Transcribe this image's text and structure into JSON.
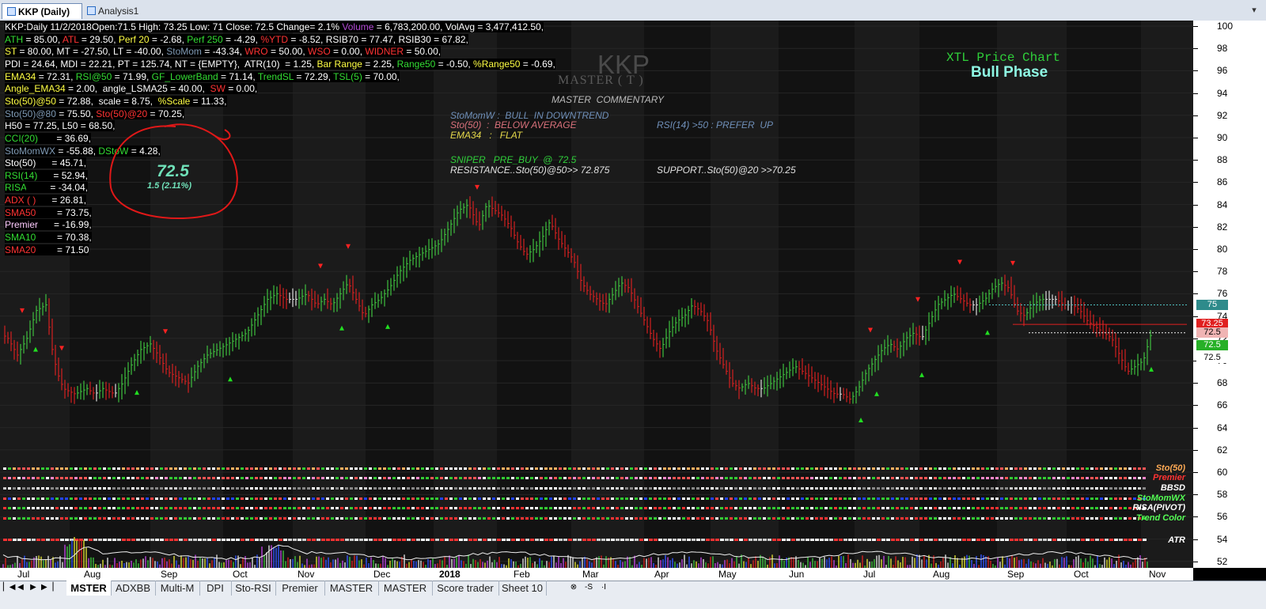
{
  "tabs": [
    {
      "label": "KKP (Daily)",
      "active": true
    },
    {
      "label": "Analysis1",
      "active": false
    }
  ],
  "info_lines": [
    [
      {
        "t": "KKP:Daily 11/2/2018Open:71.5 High: 73.25 Low: 71 Close: 72.5 Change= 2.1% ",
        "c": "#ffffff"
      },
      {
        "t": "Volume",
        "c": "#b44bd6"
      },
      {
        "t": " = 6,783,200.00, VolAvg = 3,477,412.50,",
        "c": "#ffffff"
      }
    ],
    [
      {
        "t": "ATH",
        "c": "#33dd33"
      },
      {
        "t": " = 85.00, ",
        "c": "#ffffff"
      },
      {
        "t": "ATL",
        "c": "#ff3333"
      },
      {
        "t": " = 29.50, ",
        "c": "#ffffff"
      },
      {
        "t": "Perf 20",
        "c": "#ffff44"
      },
      {
        "t": " = -2.68, ",
        "c": "#ffffff"
      },
      {
        "t": "Perf 250",
        "c": "#33dd33"
      },
      {
        "t": " = -4.29, ",
        "c": "#ffffff"
      },
      {
        "t": "%YTD",
        "c": "#ff3333"
      },
      {
        "t": " = -8.52, RSIB70 = 77.47, RSIB30 = 67.82,",
        "c": "#ffffff"
      }
    ],
    [
      {
        "t": "ST",
        "c": "#ffff44"
      },
      {
        "t": " = 80.00, MT = -27.50, LT = -40.00, ",
        "c": "#ffffff"
      },
      {
        "t": "StoMom",
        "c": "#7f9ab4"
      },
      {
        "t": " = -43.34, ",
        "c": "#ffffff"
      },
      {
        "t": "WRO",
        "c": "#ff3333"
      },
      {
        "t": " = 50.00, ",
        "c": "#ffffff"
      },
      {
        "t": "WSO",
        "c": "#ff3333"
      },
      {
        "t": " = 0.00, ",
        "c": "#ffffff"
      },
      {
        "t": "WIDNER",
        "c": "#ff3333"
      },
      {
        "t": " = 50.00,",
        "c": "#ffffff"
      }
    ],
    [
      {
        "t": "PDI = 24.64, MDI = 22.21, PT = 125.74, NT = {EMPTY},  ATR(10)  = 1.25, ",
        "c": "#ffffff"
      },
      {
        "t": "Bar Range",
        "c": "#ffff44"
      },
      {
        "t": " = 2.25, ",
        "c": "#ffffff"
      },
      {
        "t": "Range50",
        "c": "#33dd33"
      },
      {
        "t": " = -0.50, ",
        "c": "#ffffff"
      },
      {
        "t": "%Range50",
        "c": "#ffff44"
      },
      {
        "t": " = -0.69,",
        "c": "#ffffff"
      }
    ],
    [
      {
        "t": "EMA34",
        "c": "#ffff44"
      },
      {
        "t": " = 72.31, ",
        "c": "#ffffff"
      },
      {
        "t": "RSI@50",
        "c": "#33dd33"
      },
      {
        "t": " = 71.99, ",
        "c": "#ffffff"
      },
      {
        "t": "GF_LowerBand",
        "c": "#33dd33"
      },
      {
        "t": " = 71.14, ",
        "c": "#ffffff"
      },
      {
        "t": "TrendSL",
        "c": "#33dd33"
      },
      {
        "t": " = 72.29, ",
        "c": "#ffffff"
      },
      {
        "t": "TSL(5)",
        "c": "#33dd33"
      },
      {
        "t": " = 70.00,",
        "c": "#ffffff"
      }
    ],
    [
      {
        "t": "Angle_EMA34",
        "c": "#ffff44"
      },
      {
        "t": " = 2.00,  angle_LSMA25 = 40.00,  ",
        "c": "#ffffff"
      },
      {
        "t": "SW",
        "c": "#ff3333"
      },
      {
        "t": " = 0.00,",
        "c": "#ffffff"
      }
    ],
    [
      {
        "t": "Sto(50)@50",
        "c": "#ffff44"
      },
      {
        "t": " = 72.88,  scale = 8.75,  ",
        "c": "#ffffff"
      },
      {
        "t": "%Scale",
        "c": "#ffff44"
      },
      {
        "t": " = 11.33,",
        "c": "#ffffff"
      }
    ],
    [
      {
        "t": "Sto(50)@80",
        "c": "#7f9ab4"
      },
      {
        "t": " = 75.50, ",
        "c": "#ffffff"
      },
      {
        "t": "Sto(50)@20",
        "c": "#ff3333"
      },
      {
        "t": " = 70.25,",
        "c": "#ffffff"
      }
    ],
    [
      {
        "t": "H50 = 77.25, L50 = 68.50,",
        "c": "#ffffff"
      }
    ],
    [
      {
        "t": "CCI(20)",
        "c": "#33dd33"
      },
      {
        "t": "       = 36.69,",
        "c": "#ffffff"
      }
    ],
    [
      {
        "t": "StoMomWX",
        "c": "#7f9ab4"
      },
      {
        "t": " = -55.88, ",
        "c": "#ffffff"
      },
      {
        "t": "DStoW",
        "c": "#33dd33"
      },
      {
        "t": " = 4.28,",
        "c": "#ffffff"
      }
    ],
    [
      {
        "t": "Sto(50)",
        "c": "#ffffff"
      },
      {
        "t": "      = 45.71,",
        "c": "#ffffff"
      }
    ],
    [
      {
        "t": "RSI(14)",
        "c": "#33dd33"
      },
      {
        "t": "      = 52.94,",
        "c": "#ffffff"
      }
    ],
    [
      {
        "t": "RISA",
        "c": "#33dd33"
      },
      {
        "t": "         = -34.04,",
        "c": "#ffffff"
      }
    ],
    [
      {
        "t": "ADX ( )",
        "c": "#ff3333"
      },
      {
        "t": "      = 26.81,",
        "c": "#ffffff"
      }
    ],
    [
      {
        "t": "SMA50",
        "c": "#ff3333"
      },
      {
        "t": "        = 73.75,",
        "c": "#ffffff"
      }
    ],
    [
      {
        "t": "Premier",
        "c": "#ffccff"
      },
      {
        "t": "      = -16.99,",
        "c": "#ffffff"
      }
    ],
    [
      {
        "t": "SMA10",
        "c": "#33dd33"
      },
      {
        "t": "        = 70.38,",
        "c": "#ffffff"
      }
    ],
    [
      {
        "t": "SMA20",
        "c": "#ff3333"
      },
      {
        "t": "        = 71.50",
        "c": "#ffffff"
      }
    ]
  ],
  "price_circle": {
    "price": "72.5",
    "change": "1.5  (2.11%)"
  },
  "symbol": "KKP",
  "master_label": "MASTER  ( T )",
  "commentary_title": "MASTER  COMMENTARY",
  "commentary": [
    {
      "t": "StoMomW :  BULL  IN DOWNTREND",
      "c": "#6f8fb8"
    },
    {
      "t": "Sto(50)  :  BELOW AVERAGE",
      "c": "#d9717b"
    },
    {
      "t": "EMA34   :   FLAT",
      "c": "#e5d84a"
    },
    {
      "t": "SNIPER   PRE_BUY  @  72.5",
      "c": "#2fcf3a"
    },
    {
      "t": "RESISTANCE..Sto(50)@50>> 72.875",
      "c": "#e0e0e0"
    }
  ],
  "commentary_right": [
    {
      "t": "RSI(14) >50 : PREFER  UP",
      "c": "#6f8fb8"
    },
    {
      "t": "SUPPORT..Sto(50)@20 >>70.25",
      "c": "#e0e0e0"
    }
  ],
  "chart_title": "XTL Price Chart",
  "phase": "Bull Phase",
  "y_ticks": [
    "100",
    "98",
    "96",
    "94",
    "92",
    "90",
    "88",
    "86",
    "84",
    "82",
    "80",
    "78",
    "76",
    "74",
    "72",
    "70",
    "68",
    "66",
    "64",
    "62",
    "60",
    "58",
    "56",
    "54",
    "52"
  ],
  "price_tags": [
    {
      "v": "75",
      "bg": "#2e8b8b",
      "fg": "#ffffff"
    },
    {
      "v": "73.25",
      "bg": "#e02020",
      "fg": "#ffffff"
    },
    {
      "v": "72.5",
      "bg": "#f0b4b4",
      "fg": "#000000"
    },
    {
      "v": "72.5",
      "bg": "#27b027",
      "fg": "#ffffff"
    },
    {
      "v": "72.5",
      "bg": "#ffffff",
      "fg": "#000000"
    }
  ],
  "indicators": [
    {
      "label": "Sto(50)",
      "c": "#ffaa55"
    },
    {
      "label": "Premier",
      "c": "#ff3333"
    },
    {
      "label": "BBSD",
      "c": "#ffffff"
    },
    {
      "label": "StoMomWX",
      "c": "#55ff55"
    },
    {
      "label": "RISA(PIVOT)",
      "c": "#ffffff"
    },
    {
      "label": "Trend Color",
      "c": "#55ff55"
    },
    {
      "label": "ATR",
      "c": "#ffffff"
    }
  ],
  "x_ticks": [
    "Jul",
    "Aug",
    "Sep",
    "Oct",
    "Nov",
    "Dec",
    "2018",
    "Feb",
    "Mar",
    "Apr",
    "May",
    "Jun",
    "Jul",
    "Aug",
    "Sep",
    "Oct",
    "Nov"
  ],
  "sheets": [
    {
      "label": "MSTER",
      "active": true
    },
    {
      "label": "ADXBB",
      "active": false
    },
    {
      "label": "Multi-M",
      "active": false
    },
    {
      "label": "DPI",
      "active": false
    },
    {
      "label": "Sto-RSI",
      "active": false
    },
    {
      "label": "Premier",
      "active": false
    },
    {
      "label": "MASTER",
      "active": false
    },
    {
      "label": "MASTER",
      "active": false
    },
    {
      "label": "Score trader",
      "active": false
    },
    {
      "label": "Sheet 10",
      "active": false
    }
  ],
  "sheet_controls": {
    "add": "⊗",
    "first": "▏◀",
    "prev": "◀",
    "next": "▶",
    "last": "▶▕",
    "nav_sep": "-S",
    "nav_sep2": "·I"
  },
  "colors": {
    "up": "#3fbf3f",
    "down": "#d42020",
    "neutral": "#dddddd",
    "buy_marker": "#22dd22",
    "sell_marker": "#ff2222",
    "resistance": "#4fc0c0"
  },
  "chart_data": {
    "type": "ohlc-bar",
    "title": "XTL Price Chart",
    "ylim": [
      51,
      100.5
    ],
    "x_labels": [
      "Jul",
      "Aug",
      "Sep",
      "Oct",
      "Nov",
      "Dec",
      "2018",
      "Feb",
      "Mar",
      "Apr",
      "May",
      "Jun",
      "Jul",
      "Aug",
      "Sep",
      "Oct",
      "Nov"
    ],
    "close_path": [
      {
        "d": 0,
        "v": 72.5
      },
      {
        "d": 10,
        "v": 72
      },
      {
        "d": 22,
        "v": 70.5
      },
      {
        "d": 34,
        "v": 72
      },
      {
        "d": 46,
        "v": 74.5
      },
      {
        "d": 58,
        "v": 75
      },
      {
        "d": 66,
        "v": 71
      },
      {
        "d": 72,
        "v": 69
      },
      {
        "d": 80,
        "v": 67.5
      },
      {
        "d": 95,
        "v": 67
      },
      {
        "d": 110,
        "v": 67.5
      },
      {
        "d": 120,
        "v": 67
      },
      {
        "d": 130,
        "v": 67.5
      },
      {
        "d": 145,
        "v": 67
      },
      {
        "d": 155,
        "v": 68
      },
      {
        "d": 165,
        "v": 69.5
      },
      {
        "d": 178,
        "v": 71
      },
      {
        "d": 190,
        "v": 71.5
      },
      {
        "d": 200,
        "v": 70.5
      },
      {
        "d": 212,
        "v": 69
      },
      {
        "d": 225,
        "v": 68.5
      },
      {
        "d": 238,
        "v": 68
      },
      {
        "d": 250,
        "v": 69.5
      },
      {
        "d": 262,
        "v": 70.5
      },
      {
        "d": 275,
        "v": 71
      },
      {
        "d": 288,
        "v": 71.5
      },
      {
        "d": 300,
        "v": 72
      },
      {
        "d": 312,
        "v": 72.5
      },
      {
        "d": 325,
        "v": 74
      },
      {
        "d": 338,
        "v": 75.5
      },
      {
        "d": 350,
        "v": 76
      },
      {
        "d": 362,
        "v": 75.5
      },
      {
        "d": 375,
        "v": 75.5
      },
      {
        "d": 388,
        "v": 76
      },
      {
        "d": 400,
        "v": 75
      },
      {
        "d": 410,
        "v": 75.5
      },
      {
        "d": 420,
        "v": 75
      },
      {
        "d": 430,
        "v": 76
      },
      {
        "d": 440,
        "v": 77
      },
      {
        "d": 450,
        "v": 75.5
      },
      {
        "d": 460,
        "v": 74
      },
      {
        "d": 470,
        "v": 75
      },
      {
        "d": 480,
        "v": 75.5
      },
      {
        "d": 492,
        "v": 76.5
      },
      {
        "d": 505,
        "v": 78
      },
      {
        "d": 518,
        "v": 79
      },
      {
        "d": 530,
        "v": 79.5
      },
      {
        "d": 543,
        "v": 80
      },
      {
        "d": 555,
        "v": 80.5
      },
      {
        "d": 568,
        "v": 82
      },
      {
        "d": 580,
        "v": 83.5
      },
      {
        "d": 592,
        "v": 84
      },
      {
        "d": 605,
        "v": 82
      },
      {
        "d": 615,
        "v": 84
      },
      {
        "d": 625,
        "v": 83.5
      },
      {
        "d": 635,
        "v": 83
      },
      {
        "d": 645,
        "v": 82
      },
      {
        "d": 655,
        "v": 80.5
      },
      {
        "d": 665,
        "v": 79.5
      },
      {
        "d": 675,
        "v": 80
      },
      {
        "d": 685,
        "v": 81
      },
      {
        "d": 695,
        "v": 82.5
      },
      {
        "d": 705,
        "v": 81
      },
      {
        "d": 715,
        "v": 80
      },
      {
        "d": 725,
        "v": 79
      },
      {
        "d": 735,
        "v": 77
      },
      {
        "d": 745,
        "v": 76
      },
      {
        "d": 755,
        "v": 75.5
      },
      {
        "d": 765,
        "v": 75
      },
      {
        "d": 775,
        "v": 76
      },
      {
        "d": 785,
        "v": 77
      },
      {
        "d": 795,
        "v": 76.5
      },
      {
        "d": 805,
        "v": 75
      },
      {
        "d": 815,
        "v": 73.5
      },
      {
        "d": 825,
        "v": 72
      },
      {
        "d": 835,
        "v": 71
      },
      {
        "d": 845,
        "v": 72.5
      },
      {
        "d": 855,
        "v": 73.5
      },
      {
        "d": 865,
        "v": 74
      },
      {
        "d": 875,
        "v": 75
      },
      {
        "d": 885,
        "v": 74.5
      },
      {
        "d": 895,
        "v": 73.5
      },
      {
        "d": 905,
        "v": 71
      },
      {
        "d": 915,
        "v": 69.5
      },
      {
        "d": 925,
        "v": 68
      },
      {
        "d": 935,
        "v": 67.5
      },
      {
        "d": 945,
        "v": 68
      },
      {
        "d": 955,
        "v": 67.5
      },
      {
        "d": 965,
        "v": 67.5
      },
      {
        "d": 975,
        "v": 68
      },
      {
        "d": 985,
        "v": 68.5
      },
      {
        "d": 995,
        "v": 69
      },
      {
        "d": 1005,
        "v": 69.5
      },
      {
        "d": 1015,
        "v": 69
      },
      {
        "d": 1025,
        "v": 68.5
      },
      {
        "d": 1035,
        "v": 68
      },
      {
        "d": 1045,
        "v": 67.5
      },
      {
        "d": 1055,
        "v": 67
      },
      {
        "d": 1065,
        "v": 67
      },
      {
        "d": 1075,
        "v": 66.5
      },
      {
        "d": 1085,
        "v": 67.5
      },
      {
        "d": 1095,
        "v": 69
      },
      {
        "d": 1105,
        "v": 70
      },
      {
        "d": 1115,
        "v": 71
      },
      {
        "d": 1125,
        "v": 71.5
      },
      {
        "d": 1135,
        "v": 71
      },
      {
        "d": 1145,
        "v": 72
      },
      {
        "d": 1155,
        "v": 72.5
      },
      {
        "d": 1165,
        "v": 72
      },
      {
        "d": 1175,
        "v": 73.5
      },
      {
        "d": 1185,
        "v": 75
      },
      {
        "d": 1195,
        "v": 75.5
      },
      {
        "d": 1205,
        "v": 76
      },
      {
        "d": 1215,
        "v": 75.5
      },
      {
        "d": 1225,
        "v": 75
      },
      {
        "d": 1235,
        "v": 75
      },
      {
        "d": 1245,
        "v": 75.5
      },
      {
        "d": 1255,
        "v": 76.5
      },
      {
        "d": 1265,
        "v": 77
      },
      {
        "d": 1275,
        "v": 76.5
      },
      {
        "d": 1285,
        "v": 74.5
      },
      {
        "d": 1295,
        "v": 74
      },
      {
        "d": 1305,
        "v": 75
      },
      {
        "d": 1315,
        "v": 75.5
      },
      {
        "d": 1325,
        "v": 75.5
      },
      {
        "d": 1335,
        "v": 75.5
      },
      {
        "d": 1345,
        "v": 75
      },
      {
        "d": 1355,
        "v": 75
      },
      {
        "d": 1365,
        "v": 74.5
      },
      {
        "d": 1375,
        "v": 73.5
      },
      {
        "d": 1385,
        "v": 73
      },
      {
        "d": 1395,
        "v": 72.5
      },
      {
        "d": 1405,
        "v": 72
      },
      {
        "d": 1415,
        "v": 70.5
      },
      {
        "d": 1425,
        "v": 69
      },
      {
        "d": 1435,
        "v": 69.5
      },
      {
        "d": 1445,
        "v": 70
      },
      {
        "d": 1455,
        "v": 72.5
      }
    ],
    "levels": [
      {
        "v": 75,
        "color": "#4fc0c0"
      },
      {
        "v": 73.25,
        "color": "#e02020"
      },
      {
        "v": 72.5,
        "color": "#f0f0f0"
      }
    ],
    "buy_markers": [
      45,
      173,
      291,
      432,
      490,
      1088,
      1108,
      1165,
      1248,
      1455
    ],
    "sell_markers": [
      28,
      78,
      209,
      405,
      440,
      603,
      1100,
      1160,
      1213,
      1280
    ]
  }
}
